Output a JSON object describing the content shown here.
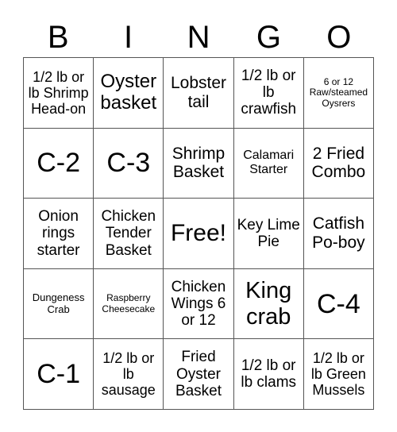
{
  "header": [
    "B",
    "I",
    "N",
    "G",
    "O"
  ],
  "cells": [
    {
      "text": "1/2 lb or lb Shrimp Head-on",
      "size": 18
    },
    {
      "text": "Oyster basket",
      "size": 24
    },
    {
      "text": "Lobster tail",
      "size": 21
    },
    {
      "text": "1/2 lb or lb crawfish",
      "size": 19
    },
    {
      "text": "6 or 12 Raw/steamed Oysrers",
      "size": 12
    },
    {
      "text": "C-2",
      "size": 34
    },
    {
      "text": "C-3",
      "size": 34
    },
    {
      "text": "Shrimp Basket",
      "size": 21
    },
    {
      "text": "Calamari Starter",
      "size": 16
    },
    {
      "text": "2 Fried Combo",
      "size": 21
    },
    {
      "text": "Onion rings starter",
      "size": 19
    },
    {
      "text": "Chicken Tender Basket",
      "size": 19
    },
    {
      "text": "Free!",
      "size": 30
    },
    {
      "text": "Key Lime Pie",
      "size": 19
    },
    {
      "text": "Catfish Po-boy",
      "size": 21
    },
    {
      "text": "Dungeness Crab",
      "size": 13
    },
    {
      "text": "Raspberry Cheesecake",
      "size": 12
    },
    {
      "text": "Chicken Wings 6 or 12",
      "size": 19
    },
    {
      "text": "King crab",
      "size": 29
    },
    {
      "text": "C-4",
      "size": 34
    },
    {
      "text": "C-1",
      "size": 34
    },
    {
      "text": "1/2 lb or lb sausage",
      "size": 18
    },
    {
      "text": "Fried Oyster Basket",
      "size": 19
    },
    {
      "text": "1/2 lb or lb clams",
      "size": 19
    },
    {
      "text": "1/2 lb or lb Green Mussels",
      "size": 18
    }
  ]
}
